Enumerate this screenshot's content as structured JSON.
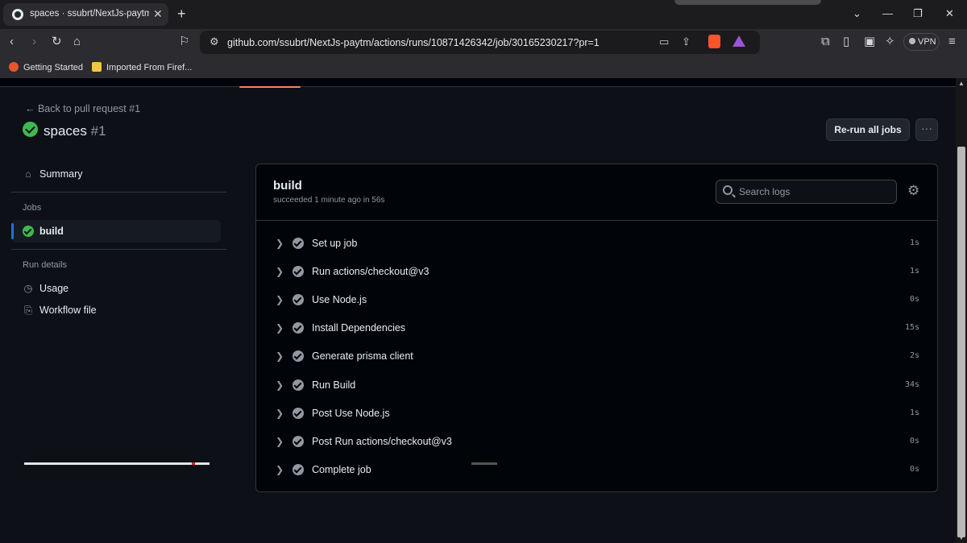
{
  "browser": {
    "tab_title": "spaces · ssubrt/NextJs-paytm",
    "url": "github.com/ssubrt/NextJs-paytm/actions/runs/10871426342/job/30165230217?pr=1",
    "vpn_label": "VPN",
    "bookmarks": [
      "Getting Started",
      "Imported From Firef..."
    ]
  },
  "run": {
    "back_link": "← Back to pull request #1",
    "title": "spaces",
    "number": "#1",
    "rerun_label": "Re-run all jobs",
    "more_label": "···"
  },
  "sidebar": {
    "summary": "Summary",
    "jobs_heading": "Jobs",
    "job": "build",
    "run_details_heading": "Run details",
    "usage": "Usage",
    "workflow_file": "Workflow file"
  },
  "job": {
    "title": "build",
    "subtitle": "succeeded 1 minute ago in 56s",
    "search_placeholder": "Search logs",
    "steps": [
      {
        "name": "Set up job",
        "duration": "1s"
      },
      {
        "name": "Run actions/checkout@v3",
        "duration": "1s"
      },
      {
        "name": "Use Node.js",
        "duration": "0s"
      },
      {
        "name": "Install Dependencies",
        "duration": "15s"
      },
      {
        "name": "Generate prisma client",
        "duration": "2s"
      },
      {
        "name": "Run Build",
        "duration": "34s"
      },
      {
        "name": "Post Use Node.js",
        "duration": "1s"
      },
      {
        "name": "Post Run actions/checkout@v3",
        "duration": "0s"
      },
      {
        "name": "Complete job",
        "duration": "0s"
      }
    ]
  },
  "colors": {
    "success": "#3fb950",
    "accent": "#1f6feb",
    "background": "#0d1117"
  }
}
